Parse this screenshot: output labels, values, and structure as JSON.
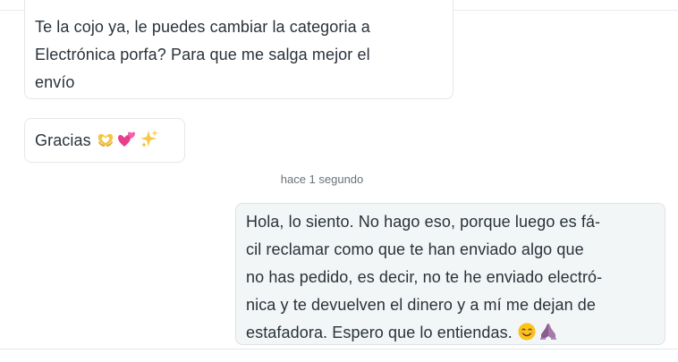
{
  "conversation": {
    "messages": [
      {
        "direction": "incoming",
        "lines": [
          "Te la cojo ya, le puedes cambiar la categoria a",
          "Electrónica porfa? Para que me salga mejor el",
          "envío"
        ]
      },
      {
        "direction": "incoming",
        "text": "Gracias",
        "emojis": [
          "heart-hands",
          "two-hearts",
          "sparkles"
        ]
      },
      {
        "direction": "outgoing",
        "timestamp": "hace 1 segundo",
        "lines": [
          "Hola, lo siento. No hago eso, porque luego es fá-",
          "cil reclamar como que te han enviado algo que",
          "no has pedido, es decir, no te he enviado electró-",
          "nica y te devuelven el dinero y a mí me dejan de",
          "estafadora. Espero que lo entiendas."
        ],
        "emojis": [
          "smiling-face-with-smiling-eyes",
          "folded-hands"
        ]
      }
    ]
  },
  "colors": {
    "text": "#29323a",
    "timestamp": "#687378",
    "incoming_bubble": "#ffffff",
    "outgoing_bubble": "#f3f6f7",
    "border": "#e3e7ea"
  }
}
